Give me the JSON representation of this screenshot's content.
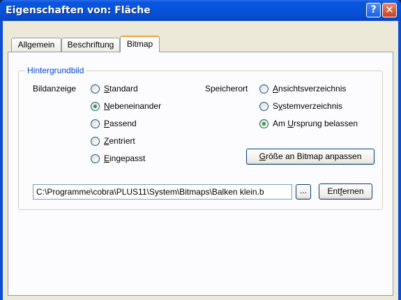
{
  "window": {
    "title": "Eigenschaften von: Fläche",
    "help_glyph": "?",
    "close_glyph": "✕"
  },
  "tabs": [
    {
      "label": "Allgemein",
      "active": false
    },
    {
      "label": "Beschriftung",
      "active": false
    },
    {
      "label": "Bitmap",
      "active": true
    }
  ],
  "group": {
    "title": "Hintergrundbild"
  },
  "bildanzeige": {
    "label": "Bildanzeige",
    "options": [
      {
        "access": "S",
        "rest": "tandard",
        "checked": false
      },
      {
        "access": "N",
        "rest": "ebeneinander",
        "checked": true
      },
      {
        "access": "P",
        "rest": "assend",
        "checked": false
      },
      {
        "access": "Z",
        "rest": "entriert",
        "checked": false
      },
      {
        "access": "E",
        "rest": "ingepasst",
        "checked": false
      }
    ]
  },
  "speicherort": {
    "label": "Speicherort",
    "options": [
      {
        "pre": "",
        "access": "A",
        "rest": "nsichtsverzeichnis",
        "checked": false
      },
      {
        "pre": "S",
        "access": "y",
        "rest": "stemverzeichnis",
        "checked": false
      },
      {
        "pre": "Am ",
        "access": "U",
        "rest": "rsprung belassen",
        "checked": true
      }
    ]
  },
  "resize_button": {
    "access": "G",
    "rest": "röße an Bitmap anpassen"
  },
  "path_field": {
    "value": "C:\\Programme\\cobra\\PLUS11\\System\\Bitmaps\\Balken klein.b"
  },
  "browse_button": {
    "label": "..."
  },
  "remove_button": {
    "pre": "Ent",
    "access": "f",
    "rest": "ernen"
  }
}
